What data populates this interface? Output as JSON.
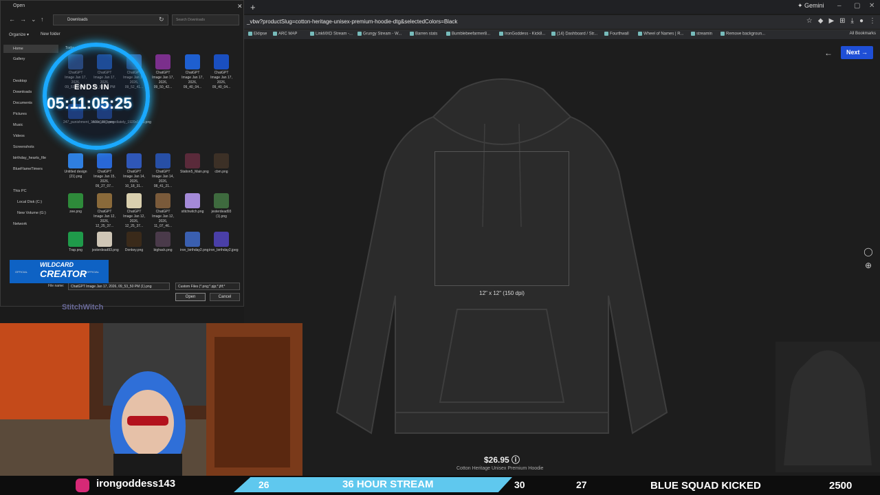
{
  "browser": {
    "new_tab": "+",
    "gemini": "✦ Gemini",
    "url": "_vbw?productSlug=cotton-heritage-unisex-premium-hoodie-dtg&selectedColors=Black",
    "bookmarks": [
      "Eklipse",
      "ARC MAP",
      "LinkMXD Stream -...",
      "Grungy Stream - W...",
      "Barren stats",
      "Bumblebeefarmer8...",
      "IronGoddess - Kick8...",
      "(14) Dashboard / Str...",
      "Fourthwall",
      "Wheel of Names | R...",
      "streamin",
      "Remove backgroun..."
    ],
    "all_bookmarks": "All Bookmarks"
  },
  "page": {
    "next_label": "Next →",
    "back_label": "←",
    "print_dims": "12\" x 12\" (150 dpi)",
    "price": "$26.95 ⓘ",
    "product_name": "Cotton Heritage Unisex Premium Hoodie",
    "side_icon1": "◯",
    "side_icon2": "⊕"
  },
  "dialog": {
    "title": "Open",
    "close": "✕",
    "path": "Downloads",
    "search_placeholder": "Search Downloads",
    "organize": "Organize ▾",
    "new_folder": "New folder",
    "nav": {
      "home": "Home",
      "gallery": "Gallery",
      "desktop": "Desktop",
      "downloads": "Downloads",
      "documents": "Documents",
      "pictures": "Pictures",
      "music": "Music",
      "videos": "Videos",
      "screenshots": "Screenshots",
      "birthday": "birthday_hearts_file",
      "bluefl": "BlueFlameTimers",
      "thispc": "This PC",
      "localdisk": "Local Disk (C:)",
      "newvol": "New Volume (G:)",
      "network": "Network"
    },
    "section_today": "Today",
    "files": [
      "ChatGPT Image Jan 17, 2026, 09_53_50 PM",
      "ChatGPT Image Jan 17, 2026, 09_52_41 PM",
      "ChatGPT Image Jan 17, 2026, 09_52_41...",
      "ChatGPT Image Jan 17, 2026, 09_50_42...",
      "ChatGPT Image Jan 17, 2026, 09_40_04...",
      "ChatGPT Image Jan 17, 2026, 09_40_04...",
      "247_punishment_1920x1080.png",
      "must_do_immediately_1920x1080.png",
      "Untitled design (21).png",
      "ChatGPT Image Jan 15, 2026, 09_27_07...",
      "ChatGPT Image Jan 14, 2026, 10_18_31...",
      "ChatGPT Image Jan 14, 2026, 08_41_21...",
      "Station5_Main.png",
      "cbm.png",
      "zee.png",
      "ChatGPT Image Jan 12, 2026, 12_25_37...",
      "ChatGPT Image Jan 12, 2026, 12_25_37...",
      "ChatGPT Image Jan 12, 2026, 11_07_46...",
      "stitchwitch.png",
      "jesterdead93 (1).png",
      "Trap.png",
      "jesterdead93.png",
      "Donkey.png",
      "bighack.png",
      "iron_birthday2.png",
      "iron_birthday2.jpeg"
    ],
    "filename_label": "File name:",
    "filename_value": "ChatGPT Image Jan 17, 2026, 09_53_50 PM (1).png",
    "filter_value": "Custom Files (*.png;*.pjp;*.jfif;*",
    "open_label": "Open",
    "cancel_label": "Cancel"
  },
  "overlay": {
    "timer_caption": "ENDS IN",
    "timer_value": "05:11:05:25",
    "wildcard_title": "WILDCARD",
    "wildcard_sub": "CREATOR",
    "official": "OFFICIAL",
    "stitch": "StitchWitch",
    "handle": "irongoddess143",
    "num26": "26",
    "stream_text": "36 HOUR STREAM",
    "num30": "30",
    "num27": "27",
    "kicked": "BLUE SQUAD KICKED",
    "num2500": "2500"
  }
}
